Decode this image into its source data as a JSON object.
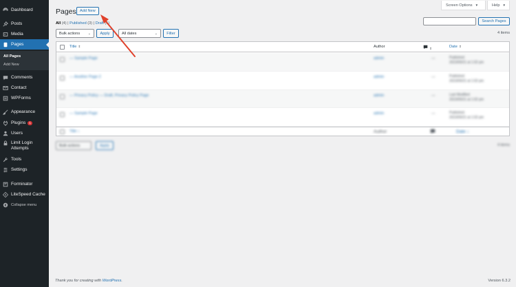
{
  "sidebar": {
    "items": [
      {
        "label": "Dashboard",
        "icon": "dashboard-icon"
      },
      {
        "label": "Posts",
        "icon": "pin-icon"
      },
      {
        "label": "Media",
        "icon": "media-icon"
      },
      {
        "label": "Pages",
        "icon": "pages-icon",
        "active": true
      },
      {
        "label": "Comments",
        "icon": "comment-icon"
      },
      {
        "label": "Contact",
        "icon": "mail-icon"
      },
      {
        "label": "WPForms",
        "icon": "forms-icon"
      },
      {
        "label": "Appearance",
        "icon": "brush-icon"
      },
      {
        "label": "Plugins",
        "icon": "plugin-icon",
        "badge": "1"
      },
      {
        "label": "Users",
        "icon": "users-icon"
      },
      {
        "label": "Limit Login Attempts",
        "icon": "lock-icon"
      },
      {
        "label": "Tools",
        "icon": "wrench-icon"
      },
      {
        "label": "Settings",
        "icon": "settings-icon"
      },
      {
        "label": "Forminator",
        "icon": "forminator-icon"
      },
      {
        "label": "LiteSpeed Cache",
        "icon": "litespeed-icon"
      },
      {
        "label": "Collapse menu",
        "icon": "collapse-icon"
      }
    ],
    "submenu": [
      {
        "label": "All Pages",
        "current": true
      },
      {
        "label": "Add New"
      }
    ]
  },
  "topbar": {
    "screen_options": "Screen Options",
    "help": "Help"
  },
  "header": {
    "title": "Pages",
    "add_new": "Add New"
  },
  "filters": {
    "all": "All",
    "all_count": "(4)",
    "published": "Published",
    "published_count": "(3)",
    "draft": "Draft",
    "draft_count": "(1)",
    "separator": "|"
  },
  "search": {
    "placeholder": "",
    "button": "Search Pages"
  },
  "bulk": {
    "select": "Bulk actions",
    "apply": "Apply",
    "dates": "All dates",
    "filter": "Filter",
    "items_count": "4 items"
  },
  "table": {
    "columns": {
      "title": "Title",
      "author": "Author",
      "date": "Date"
    },
    "rows": [
      {
        "title": "— Sample Page",
        "author": "admin",
        "comments": "—",
        "date1": "Published",
        "date2": "2023/09/21 at 1:02 pm"
      },
      {
        "title": "— Another Page 2",
        "author": "admin",
        "comments": "—",
        "date1": "Published",
        "date2": "2023/09/21 at 1:02 pm"
      },
      {
        "title": "— Privacy Policy — Draft, Privacy Policy Page",
        "author": "admin",
        "comments": "—",
        "date1": "Last Modified",
        "date2": "2023/09/21 at 1:02 pm"
      },
      {
        "title": "— Sample Page",
        "author": "admin",
        "comments": "—",
        "date1": "Published",
        "date2": "2023/09/21 at 1:02 pm"
      }
    ],
    "footer": {
      "title": "Title ↕",
      "author": "Author",
      "date": "Date ↕"
    }
  },
  "bottom_bulk": {
    "select": "Bulk actions",
    "apply": "Apply",
    "items_count": "4 items"
  },
  "footer": {
    "thanks_prefix": "Thank you for creating with ",
    "thanks_link": "WordPress",
    "thanks_suffix": ".",
    "version": "Version 6.3.2"
  },
  "colors": {
    "sidebar_bg": "#1d2327",
    "accent": "#2271b1",
    "annotation_arrow": "#e0412b",
    "badge": "#d63638"
  }
}
